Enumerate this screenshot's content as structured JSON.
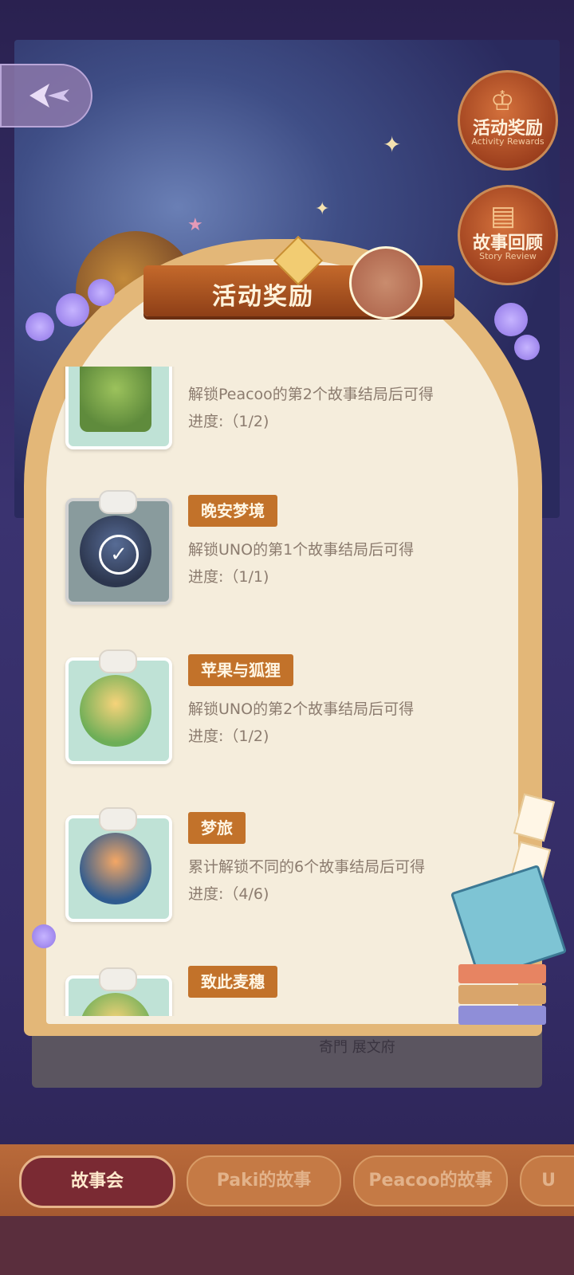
{
  "side_buttons": {
    "activity_rewards": {
      "label": "活动奖励",
      "sub": "Activity Rewards"
    },
    "story_review": {
      "label": "故事回顾",
      "sub": "Story Review"
    }
  },
  "panel": {
    "title": "活动奖励",
    "bottom_partial_text": "奇門 展文府"
  },
  "rewards": [
    {
      "name": "",
      "desc": "解锁Peacoo的第2个故事结局后可得",
      "progress": "进度:（1/2)",
      "progress_value": 0.5,
      "claimed": false
    },
    {
      "name": "晚安梦境",
      "desc": "解锁UNO的第1个故事结局后可得",
      "progress": "进度:（1/1)",
      "progress_value": 1.0,
      "claimed": true
    },
    {
      "name": "苹果与狐狸",
      "desc": "解锁UNO的第2个故事结局后可得",
      "progress": "进度:（1/2)",
      "progress_value": 0.5,
      "claimed": false
    },
    {
      "name": "梦旅",
      "desc": "累计解锁不同的6个故事结局后可得",
      "progress": "进度:（4/6)",
      "progress_value": 0.667,
      "claimed": false
    },
    {
      "name": "致此麦穗",
      "desc": "",
      "progress": "",
      "claimed": false
    }
  ],
  "tabs": [
    {
      "label": "故事会",
      "active": true
    },
    {
      "label": "Paki的故事",
      "active": false
    },
    {
      "label": "Peacoo的故事",
      "active": false
    },
    {
      "label": "U",
      "active": false
    }
  ],
  "colors": {
    "accent": "#c2722a",
    "panel_bg": "#f5eddc",
    "frame": "#e3b778",
    "ribbon": "#a3481c",
    "text": "#8c7c6f"
  }
}
